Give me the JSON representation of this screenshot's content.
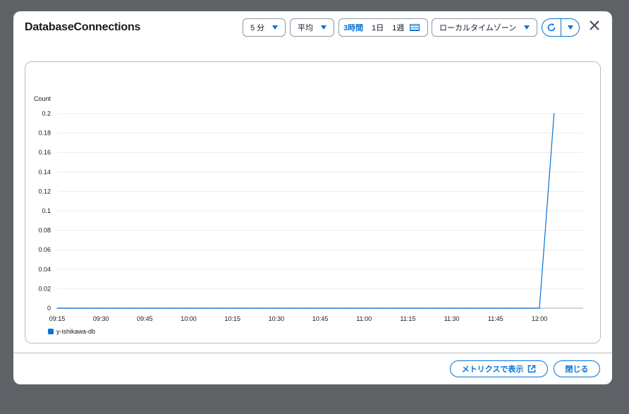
{
  "modal": {
    "title": "DatabaseConnections",
    "period_label": "5 分",
    "statistic_label": "平均",
    "range": {
      "active": "3時間",
      "day": "1日",
      "week": "1週"
    },
    "timezone_label": "ローカルタイムゾーン",
    "view_in_metrics_label": "メトリクスで表示",
    "close_label": "閉じる"
  },
  "colors": {
    "accent": "#0972d3",
    "series": "#0972d3"
  },
  "chart_data": {
    "type": "line",
    "ylabel": "Count",
    "ylim": [
      0,
      0.2
    ],
    "yticks": [
      "0.2",
      "0.18",
      "0.16",
      "0.14",
      "0.12",
      "0.1",
      "0.08",
      "0.06",
      "0.04",
      "0.02",
      "0"
    ],
    "xticks": [
      "09:15",
      "09:30",
      "09:45",
      "10:00",
      "10:15",
      "10:30",
      "10:45",
      "11:00",
      "11:15",
      "11:30",
      "11:45",
      "12:00"
    ],
    "series": [
      {
        "name": "y-ishikawa-db",
        "x": [
          "09:15",
          "09:20",
          "09:25",
          "09:30",
          "09:35",
          "09:40",
          "09:45",
          "09:50",
          "09:55",
          "10:00",
          "10:05",
          "10:10",
          "10:15",
          "10:20",
          "10:25",
          "10:30",
          "10:35",
          "10:40",
          "10:45",
          "10:50",
          "10:55",
          "11:00",
          "11:05",
          "11:10",
          "11:15",
          "11:20",
          "11:25",
          "11:30",
          "11:35",
          "11:40",
          "11:45",
          "11:50",
          "11:55",
          "12:00",
          "12:05"
        ],
        "values": [
          0,
          0,
          0,
          0,
          0,
          0,
          0,
          0,
          0,
          0,
          0,
          0,
          0,
          0,
          0,
          0,
          0,
          0,
          0,
          0,
          0,
          0,
          0,
          0,
          0,
          0,
          0,
          0,
          0,
          0,
          0,
          0,
          0,
          0,
          0.2
        ]
      }
    ]
  }
}
